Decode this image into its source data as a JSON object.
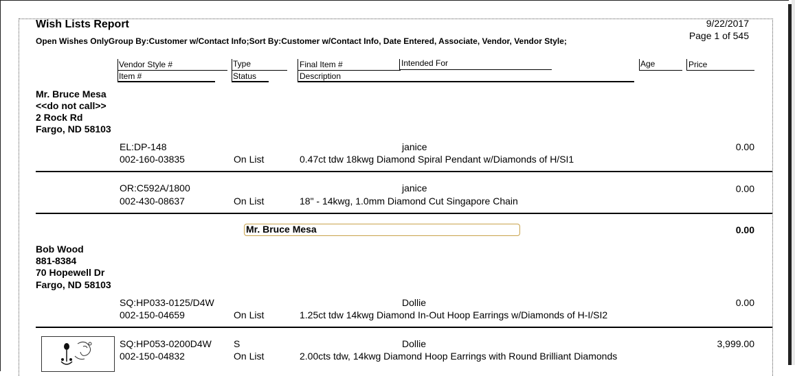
{
  "report": {
    "title": "Wish Lists Report",
    "subtitle": "Open Wishes OnlyGroup By:Customer w/Contact Info;Sort By:Customer w/Contact Info, Date Entered, Associate, Vendor, Vendor Style;",
    "date": "9/22/2017",
    "page_info": "Page 1 of 545"
  },
  "columns": {
    "vendor_style": "Vendor Style #",
    "type": "Type",
    "final_item": "Final Item #",
    "intended_for": "Intended For",
    "age": "Age",
    "price": "Price",
    "item": "Item #",
    "status": "Status",
    "description": "Description"
  },
  "customers": [
    {
      "name": "Mr. Bruce Mesa",
      "phone": "<<do not call>>",
      "address": "2 Rock Rd",
      "city": "Fargo, ND 58103",
      "items": [
        {
          "vendor_style": "EL:DP-148",
          "type": "",
          "intended_for": "janice",
          "price": "0.00",
          "item": "002-160-03835",
          "status": "On List",
          "description": "0.47ct tdw 18kwg Diamond Spiral Pendant w/Diamonds of H/SI1"
        },
        {
          "vendor_style": "OR:C592A/1800",
          "type": "",
          "intended_for": "janice",
          "price": "0.00",
          "item": "002-430-08637",
          "status": "On List",
          "description": "18\" - 14kwg, 1.0mm Diamond Cut Singapore Chain"
        }
      ],
      "subtotal_label": "Mr. Bruce Mesa",
      "subtotal_value": "0.00"
    },
    {
      "name": "Bob Wood",
      "phone": "881-8384",
      "address": "70 Hopewell Dr",
      "city": "Fargo, ND 58103",
      "items": [
        {
          "vendor_style": "SQ:HP033-0125/D4W",
          "type": "",
          "intended_for": "Dollie",
          "price": "0.00",
          "item": "002-150-04659",
          "status": "On List",
          "description": "1.25ct tdw 14kwg Diamond In-Out Hoop Earrings w/Diamonds of H-I/SI2"
        },
        {
          "vendor_style": "SQ:HP053-0200D4W",
          "type": "S",
          "intended_for": "Dollie",
          "price": "3,999.00",
          "item": "002-150-04832",
          "status": "On List",
          "description": "2.00cts tdw, 14kwg Diamond Hoop Earrings with Round Brilliant Diamonds"
        }
      ]
    }
  ],
  "icons": {
    "thumbnail": "jewelry-sketch-icon"
  }
}
